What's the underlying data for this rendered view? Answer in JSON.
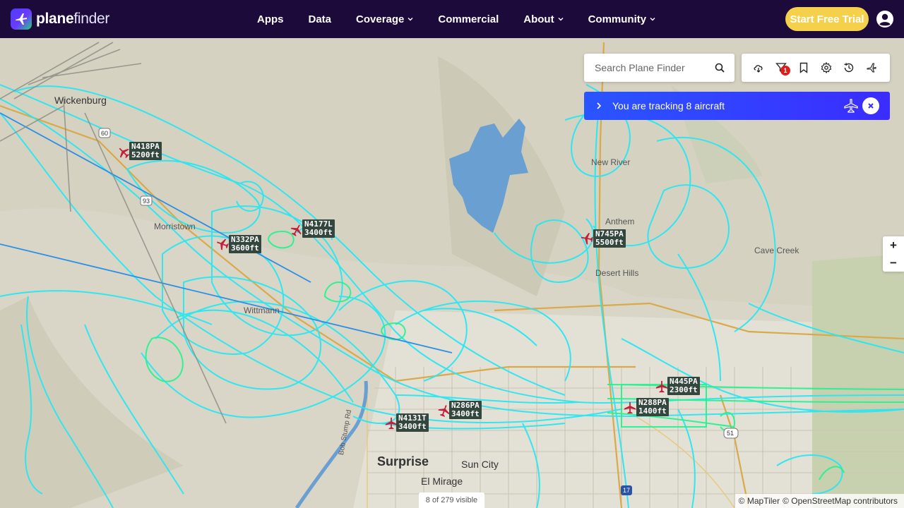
{
  "brand": {
    "name_bold": "plane",
    "name_light": "finder"
  },
  "nav": {
    "apps": "Apps",
    "data": "Data",
    "coverage": "Coverage",
    "commercial": "Commercial",
    "about": "About",
    "community": "Community"
  },
  "header": {
    "trial_label": "Start Free Trial"
  },
  "search": {
    "placeholder": "Search Plane Finder"
  },
  "toolbar": {
    "filter_badge": "1"
  },
  "tracking": {
    "text": "You are tracking 8 aircraft"
  },
  "zoom": {
    "in": "+",
    "out": "−"
  },
  "status": {
    "visible": "8 of 279 visible"
  },
  "attribution": {
    "maptiler": "© MapTiler",
    "osm": "© OpenStreetMap contributors"
  },
  "places": {
    "wickenburg": "Wickenburg",
    "morristown": "Morristown",
    "wittmann": "Wittmann",
    "new_river": "New River",
    "anthem": "Anthem",
    "desert_hills": "Desert Hills",
    "cave_creek": "Cave Creek",
    "surprise": "Surprise",
    "sun_city": "Sun City",
    "el_mirage": "El Mirage",
    "bob_stump": "Bob Stump Rd",
    "route_60": "60",
    "route_93": "93",
    "route_51": "51",
    "route_17": "17"
  },
  "aircraft": [
    {
      "callsign": "N418PA",
      "altitude": "5200ft"
    },
    {
      "callsign": "N4177L",
      "altitude": "3400ft"
    },
    {
      "callsign": "N332PA",
      "altitude": "3600ft"
    },
    {
      "callsign": "N745PA",
      "altitude": "5500ft"
    },
    {
      "callsign": "N445PA",
      "altitude": "2300ft"
    },
    {
      "callsign": "N288PA",
      "altitude": "1400ft"
    },
    {
      "callsign": "N286PA",
      "altitude": "3400ft"
    },
    {
      "callsign": "N4131T",
      "altitude": "3400ft"
    }
  ],
  "colors": {
    "header_bg": "#1c0a3a",
    "trial_bg": "#f4d04b",
    "track_primary": "#27e7f2",
    "track_low": "#1cf58d",
    "lake": "#6a9fd1",
    "plane": "#c21f3a"
  }
}
